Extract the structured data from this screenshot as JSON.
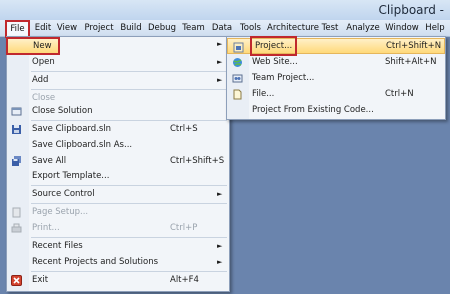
{
  "window": {
    "title": "Clipboard -"
  },
  "menubar": [
    "File",
    "Edit",
    "View",
    "Project",
    "Build",
    "Debug",
    "Team",
    "Data",
    "Tools",
    "Architecture",
    "Test",
    "Analyze",
    "Window",
    "Help"
  ],
  "file_menu": [
    {
      "label": "New",
      "shortcut": "",
      "arrow": "►",
      "state": "selected",
      "icon": ""
    },
    {
      "label": "Open",
      "shortcut": "",
      "arrow": "►",
      "state": "normal",
      "icon": ""
    },
    {
      "label": "Add",
      "shortcut": "",
      "arrow": "►",
      "state": "normal",
      "icon": ""
    },
    {
      "label": "Close",
      "shortcut": "",
      "arrow": "",
      "state": "disabled",
      "icon": ""
    },
    {
      "label": "Close Solution",
      "shortcut": "",
      "arrow": "",
      "state": "normal",
      "icon": "solution-icon"
    },
    {
      "label": "Save Clipboard.sln",
      "shortcut": "Ctrl+S",
      "arrow": "",
      "state": "normal",
      "icon": "save-icon"
    },
    {
      "label": "Save Clipboard.sln As...",
      "shortcut": "",
      "arrow": "",
      "state": "normal",
      "icon": ""
    },
    {
      "label": "Save All",
      "shortcut": "Ctrl+Shift+S",
      "arrow": "",
      "state": "normal",
      "icon": "save-all-icon"
    },
    {
      "label": "Export Template...",
      "shortcut": "",
      "arrow": "",
      "state": "normal",
      "icon": ""
    },
    {
      "label": "Source Control",
      "shortcut": "",
      "arrow": "►",
      "state": "normal",
      "icon": ""
    },
    {
      "label": "Page Setup...",
      "shortcut": "",
      "arrow": "",
      "state": "disabled",
      "icon": "page-setup-icon"
    },
    {
      "label": "Print...",
      "shortcut": "Ctrl+P",
      "arrow": "",
      "state": "disabled",
      "icon": "print-icon"
    },
    {
      "label": "Recent Files",
      "shortcut": "",
      "arrow": "►",
      "state": "normal",
      "icon": ""
    },
    {
      "label": "Recent Projects and Solutions",
      "shortcut": "",
      "arrow": "►",
      "state": "normal",
      "icon": ""
    },
    {
      "label": "Exit",
      "shortcut": "Alt+F4",
      "arrow": "",
      "state": "normal",
      "icon": "exit-icon"
    }
  ],
  "new_submenu": [
    {
      "label": "Project...",
      "shortcut": "Ctrl+Shift+N",
      "state": "selected",
      "icon": "project-icon"
    },
    {
      "label": "Web Site...",
      "shortcut": "Shift+Alt+N",
      "state": "normal",
      "icon": "web-site-icon"
    },
    {
      "label": "Team Project...",
      "shortcut": "",
      "state": "normal",
      "icon": "team-project-icon"
    },
    {
      "label": "File...",
      "shortcut": "Ctrl+N",
      "state": "normal",
      "icon": "file-icon"
    },
    {
      "label": "Project From Existing Code...",
      "shortcut": "",
      "state": "normal",
      "icon": ""
    }
  ],
  "colors": {
    "highlight_box": "#c0282d",
    "selected_bg": "#ffd97a",
    "menu_bg": "#f2f5f9",
    "desktop": "#6a84ad"
  }
}
